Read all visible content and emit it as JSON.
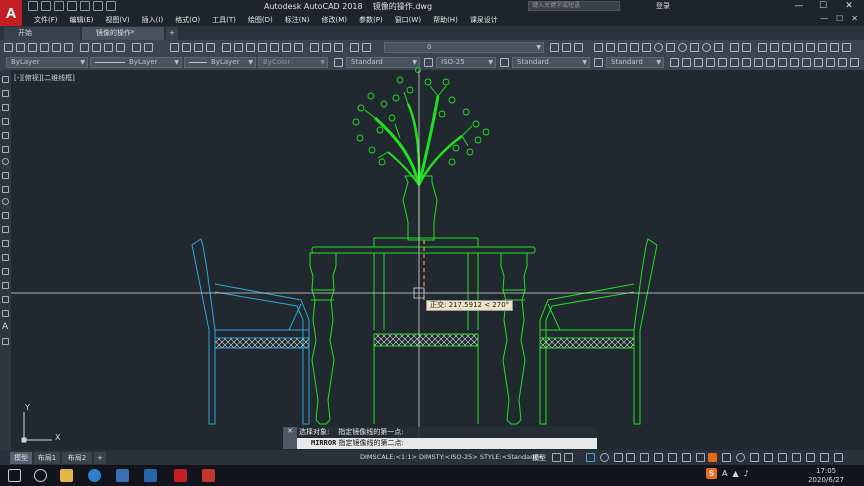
{
  "titlebar": {
    "title": "Autodesk AutoCAD 2018    镜像的操作.dwg",
    "search_placeholder": "键入关键字或短语",
    "login": "登录",
    "minimize": "—",
    "maximize": "☐",
    "close": "✕"
  },
  "menubar": {
    "items": [
      "文件(F)",
      "编辑(E)",
      "视图(V)",
      "插入(I)",
      "格式(O)",
      "工具(T)",
      "绘图(D)",
      "标注(N)",
      "修改(M)",
      "参数(P)",
      "窗口(W)",
      "帮助(H)",
      "课泉设计"
    ],
    "right_controls": [
      "—",
      "☐",
      "✕"
    ]
  },
  "tabs": {
    "start": "开始",
    "active": "镜像的操作*",
    "add": "+"
  },
  "toolbar1": {
    "layer_value": "0"
  },
  "toolbar2": {
    "layer_combo": "ByLayer",
    "linetype_combo": "ByLayer",
    "lineweight_combo": "ByLayer",
    "plotstyle_combo": "ByColor",
    "textstyle_combo": "Standard",
    "dimstyle_combo": "ISO-25",
    "tablestyle_combo": "Standard",
    "mleader_combo": "Standard"
  },
  "canvas": {
    "view_label": "[-][俯视][二维线框]",
    "tooltip": "正交: 217.5912 < 270°",
    "ucs_x": "X",
    "ucs_y": "Y",
    "colors": {
      "green": "#1fe11f",
      "cyan": "#2aa9d6",
      "crosshair": "#d9d9d9",
      "background": "#212830"
    }
  },
  "command": {
    "history": "选择对象:    指定镜像线的第一点:",
    "prompt_cmd": "MIRROR",
    "prompt_text": " 指定镜像线的第二点:",
    "close": "✕"
  },
  "layout_tabs": [
    "模型",
    "布局1",
    "布局2",
    "+"
  ],
  "status": {
    "text": "DIMSCALE:<1:1> DIMSTY:<ISO-25> STYLE:<Standard>",
    "mode": "模型"
  },
  "taskbar": {
    "time": "17:05",
    "date": "2020/6/27",
    "ime": "S",
    "lang": "A"
  }
}
